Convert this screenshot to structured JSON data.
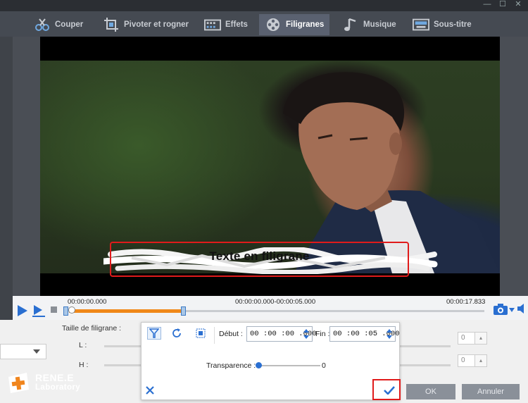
{
  "window": {
    "min_label": "—",
    "max_label": "☐",
    "close_label": "✕"
  },
  "tabs": [
    {
      "label": "Couper",
      "icon": "scissors-icon"
    },
    {
      "label": "Pivoter et rogner",
      "icon": "crop-icon"
    },
    {
      "label": "Effets",
      "icon": "film-effects-icon"
    },
    {
      "label": "Filigranes",
      "icon": "film-reel-icon",
      "active": true
    },
    {
      "label": "Musique",
      "icon": "music-note-icon"
    },
    {
      "label": "Sous-titre",
      "icon": "subtitle-icon"
    }
  ],
  "preview": {
    "watermark_text": "Texte en filigrane"
  },
  "timeline": {
    "start_time": "00:00:00.000",
    "selection_range": "00:00:00.000-00:00:05.000",
    "end_time": "00:00:17.833",
    "selection_fraction": 0.28
  },
  "settings_panel": {
    "size_label": "Taille de filigrane :",
    "width_label": "L :",
    "height_label": "H :",
    "width_value": "0",
    "height_value": "0",
    "ok_label": "OK",
    "cancel_label": "Annuler"
  },
  "logo": {
    "line1": "RENE.E",
    "line2": "Laboratory"
  },
  "popup": {
    "start_label": "Début :",
    "start_value": "00 :00 :00 .000",
    "end_label": "Fin :",
    "end_value": "00 :00 :05 .000",
    "transparency_label": "Transparence :",
    "transparency_value": "0",
    "cancel_icon": "close-x-icon",
    "confirm_icon": "checkmark-icon"
  },
  "colors": {
    "accent_blue": "#2a6fd1",
    "highlight_red": "#e01b1b",
    "progress_orange": "#f0891b",
    "logo_orange": "#f0851d"
  }
}
